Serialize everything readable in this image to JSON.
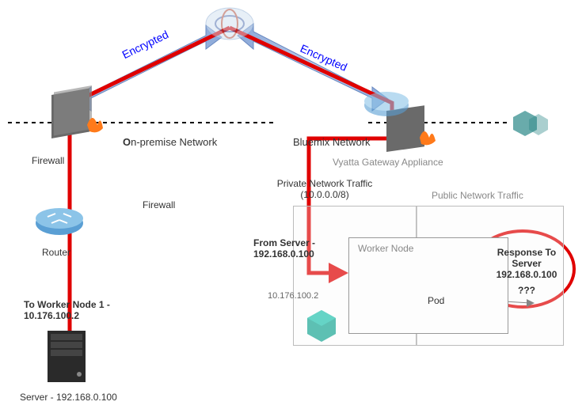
{
  "labels": {
    "encrypted_left": "Encrypted",
    "encrypted_right": "Encrypted",
    "onprem_network": "On-premise Network",
    "bluemix_network": "Bluemix Network",
    "firewall_left": "Firewall",
    "firewall_center": "Firewall",
    "router_label": "Router",
    "vyatta": "Vyatta Gateway Appliance",
    "private_traffic_title": "Private Network Traffic",
    "private_traffic_cidr": "(10.0.0.0/8)",
    "public_traffic_title": "Public Network Traffic",
    "from_server": "From Server -",
    "from_server_ip": "192.168.0.100",
    "worker_node": "Worker Node",
    "pod": "Pod",
    "worker_ip": "10.176.100.2",
    "to_worker_bold": "To Worker Node 1 -",
    "to_worker_ip": "10.176.100.2",
    "server_label": "Server - 192.168.0.100",
    "response_title": "Response To Server",
    "response_ip": "192.168.0.100",
    "response_q": "???"
  }
}
